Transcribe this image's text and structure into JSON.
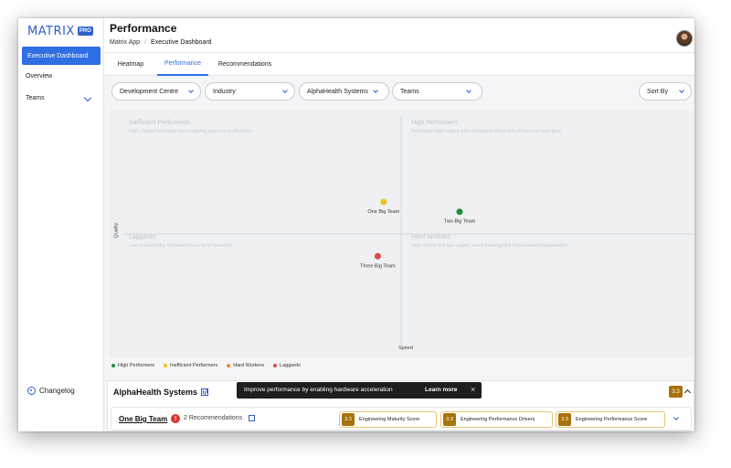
{
  "sidebar": {
    "logo_text": "MATRIX",
    "logo_badge": "PRO",
    "active_item": "Executive Dashboard",
    "items": [
      {
        "label": "Overview"
      },
      {
        "label": "Teams"
      }
    ],
    "changelog": "Changelog"
  },
  "header": {
    "title": "Performance",
    "breadcrumb": [
      "Matrix App",
      "Executive Dashboard"
    ]
  },
  "tabs": [
    {
      "label": "Heatmap",
      "active": false
    },
    {
      "label": "Performance",
      "active": true
    },
    {
      "label": "Recommendations",
      "active": false
    }
  ],
  "filters": [
    {
      "label": "Development Centre"
    },
    {
      "label": "Industry"
    },
    {
      "label": "AlphaHealth Systems"
    },
    {
      "label": "Teams"
    }
  ],
  "sort_label": "Sort By",
  "chart_data": {
    "type": "scatter",
    "xlabel": "Speed",
    "ylabel": "Quality",
    "xlim": [
      0,
      100
    ],
    "ylim": [
      0,
      100
    ],
    "quadrants": [
      {
        "title": "Inefficient Performers",
        "description": "High Output but likely encountering process inefficiency"
      },
      {
        "title": "High Performers",
        "description": "Achieving high output with dedicated effort-risk of burnout over time"
      },
      {
        "title": "Laggards",
        "description": "Low productivity, minimal hours/ time invested"
      },
      {
        "title": "Hard Workers",
        "description": "High efforts but low output; need training/skill improvement/automation"
      }
    ],
    "points": [
      {
        "name": "One Big Team",
        "x": 47,
        "y": 63,
        "color": "#f2c21b"
      },
      {
        "name": "Two Big Team",
        "x": 60,
        "y": 59,
        "color": "#1f8f3a"
      },
      {
        "name": "Three Big Team",
        "x": 46,
        "y": 41,
        "color": "#e04848"
      }
    ],
    "legend": [
      {
        "label": "High Performers",
        "color": "#1f8f3a"
      },
      {
        "label": "Inefficient Performers",
        "color": "#f2c21b"
      },
      {
        "label": "Hard Workers",
        "color": "#f08a24"
      },
      {
        "label": "Laggards",
        "color": "#e04848"
      }
    ]
  },
  "panel": {
    "title": "AlphaHealth Systems",
    "score": "3.3",
    "team": {
      "name": "One Big Team",
      "alert": "!",
      "recommendations": "2 Recommendations",
      "metrics": [
        {
          "score": "3.3",
          "label": "Engineering Maturity Score"
        },
        {
          "score": "3.3",
          "label": "Engineering Performance Drivers"
        },
        {
          "score": "3.3",
          "label": "Engineering Performance Score"
        }
      ]
    }
  },
  "toast": {
    "message": "Improve performance by enabling hardware acceleration",
    "action": "Learn more",
    "close": "×"
  }
}
